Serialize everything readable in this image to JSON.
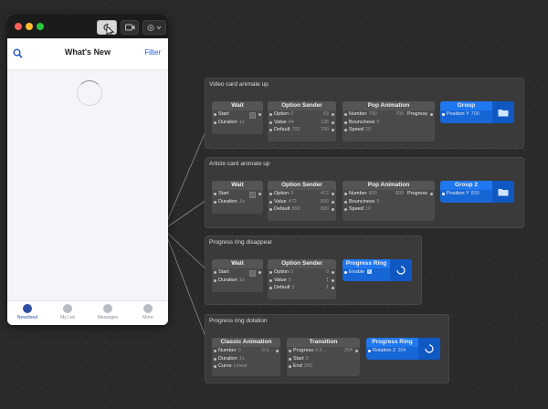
{
  "prototype": {
    "header": {
      "title": "What's New",
      "filter_label": "Filter"
    },
    "tabs": [
      {
        "label": "Newsfeed",
        "active": true
      },
      {
        "label": "My List",
        "active": false
      },
      {
        "label": "Messages",
        "active": false
      },
      {
        "label": "More",
        "active": false
      }
    ]
  },
  "groups": {
    "g1": {
      "title": "Video card animate up",
      "wait": {
        "title": "Wait",
        "start": "Start",
        "duration": "Duration",
        "duration_val": "1s"
      },
      "option": {
        "title": "Option Sender",
        "option": "Option",
        "option_val": "0",
        "option_r": "63",
        "value": "Value",
        "value_val": "64",
        "value_r": "136",
        "default": "Default",
        "default_val": "700",
        "default_r": "700"
      },
      "pop": {
        "title": "Pop Animation",
        "number": "Number",
        "number_val": "700",
        "number_r": "700",
        "progress": "Progress",
        "bounciness": "Bounciness",
        "bounciness_val": "5",
        "speed": "Speed",
        "speed_val": "20"
      },
      "out": {
        "title": "Group",
        "port": "Position Y",
        "port_val": "700"
      }
    },
    "g2": {
      "title": "Article card animate up",
      "wait": {
        "title": "Wait",
        "start": "Start",
        "duration": "Duration",
        "duration_val": "1s"
      },
      "option": {
        "title": "Option Sender",
        "option": "Option",
        "option_val": "0",
        "option_r": "472",
        "value": "Value",
        "value_val": "472",
        "value_r": "800",
        "default": "Default",
        "default_val": "800",
        "default_r": "800"
      },
      "pop": {
        "title": "Pop Animation",
        "number": "Number",
        "number_val": "800",
        "number_r": "800",
        "progress": "Progress",
        "bounciness": "Bounciness",
        "bounciness_val": "5",
        "speed": "Speed",
        "speed_val": "10"
      },
      "out": {
        "title": "Group 2",
        "port": "Position Y",
        "port_val": "800"
      }
    },
    "g3": {
      "title": "Progress ring disappear",
      "wait": {
        "title": "Wait",
        "start": "Start",
        "duration": "Duration",
        "duration_val": "1s"
      },
      "option": {
        "title": "Option Sender",
        "option": "Option",
        "option_val": "0",
        "option_r": "0",
        "value": "Value",
        "value_val": "0",
        "value_r": "1",
        "default": "Default",
        "default_val": "1",
        "default_r": "1"
      },
      "out": {
        "title": "Progress Ring",
        "port": "Enable"
      }
    },
    "g4": {
      "title": "Progress ring dotation",
      "classic": {
        "title": "Classic Animation",
        "number": "Number",
        "number_val": "0",
        "number_r": "0.5...",
        "duration": "Duration",
        "duration_val": "1s",
        "curve": "Curve",
        "curve_val": "Linear"
      },
      "transition": {
        "title": "Transition",
        "progress": "Progress",
        "progress_val": "0.5...",
        "progress_r": "204",
        "start": "Start",
        "start_val": "0",
        "end": "End",
        "end_val": "360"
      },
      "out": {
        "title": "Progress Ring",
        "port": "Rotation Z",
        "port_val": "204"
      }
    }
  },
  "colors": {
    "canvas": "#2a2a2a",
    "group": "#3a3a3a",
    "node": "#4a4a4a",
    "accent_blue": "#1f78ef"
  }
}
